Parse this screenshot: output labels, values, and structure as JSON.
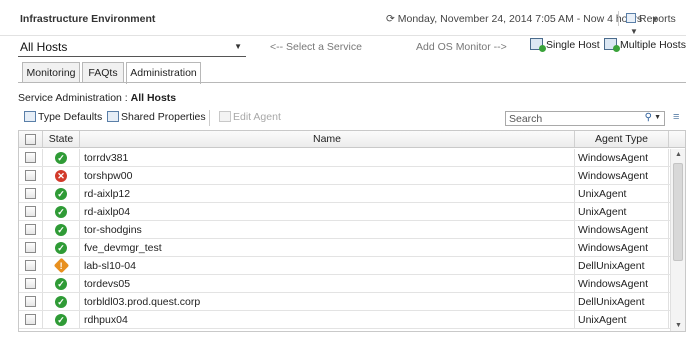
{
  "header": {
    "title": "Infrastructure Environment",
    "time_prefix": "⟳",
    "time_label": "Monday, November 24, 2014 7:05 AM - Now 4 hours",
    "reports_label": "Reports"
  },
  "host_select": {
    "value": "All Hosts"
  },
  "hints": {
    "select_service": "<-- Select a Service",
    "add_monitor": "Add OS Monitor -->"
  },
  "actions": {
    "single_host": "Single Host",
    "multiple_hosts": "Multiple Hosts"
  },
  "tabs": [
    {
      "label": "Monitoring"
    },
    {
      "label": "FAQts"
    },
    {
      "label": "Administration",
      "active": true
    }
  ],
  "service_admin": {
    "prefix": "Service Administration : ",
    "host": "All Hosts"
  },
  "toolbar": {
    "type_defaults": "Type Defaults",
    "shared_properties": "Shared Properties",
    "edit_agent": "Edit Agent",
    "search_placeholder": "Search"
  },
  "columns": {
    "state": "State",
    "name": "Name",
    "agent_type": "Agent Type"
  },
  "rows": [
    {
      "state": "ok",
      "name": "torrdv381",
      "agent_type": "WindowsAgent"
    },
    {
      "state": "error",
      "name": "torshpw00",
      "agent_type": "WindowsAgent"
    },
    {
      "state": "ok",
      "name": "rd-aixlp12",
      "agent_type": "UnixAgent"
    },
    {
      "state": "ok",
      "name": "rd-aixlp04",
      "agent_type": "UnixAgent"
    },
    {
      "state": "ok",
      "name": "tor-shodgins",
      "agent_type": "WindowsAgent"
    },
    {
      "state": "ok",
      "name": "fve_devmgr_test",
      "agent_type": "WindowsAgent"
    },
    {
      "state": "warning",
      "name": "lab-sl10-04",
      "agent_type": "DellUnixAgent"
    },
    {
      "state": "ok",
      "name": "tordevs05",
      "agent_type": "WindowsAgent"
    },
    {
      "state": "ok",
      "name": "torbldl03.prod.quest.corp",
      "agent_type": "DellUnixAgent"
    },
    {
      "state": "ok",
      "name": "rdhpux04",
      "agent_type": "UnixAgent"
    }
  ],
  "colors": {
    "ok": "#2f9b36",
    "error": "#d23a2a",
    "warning": "#e8901f"
  }
}
